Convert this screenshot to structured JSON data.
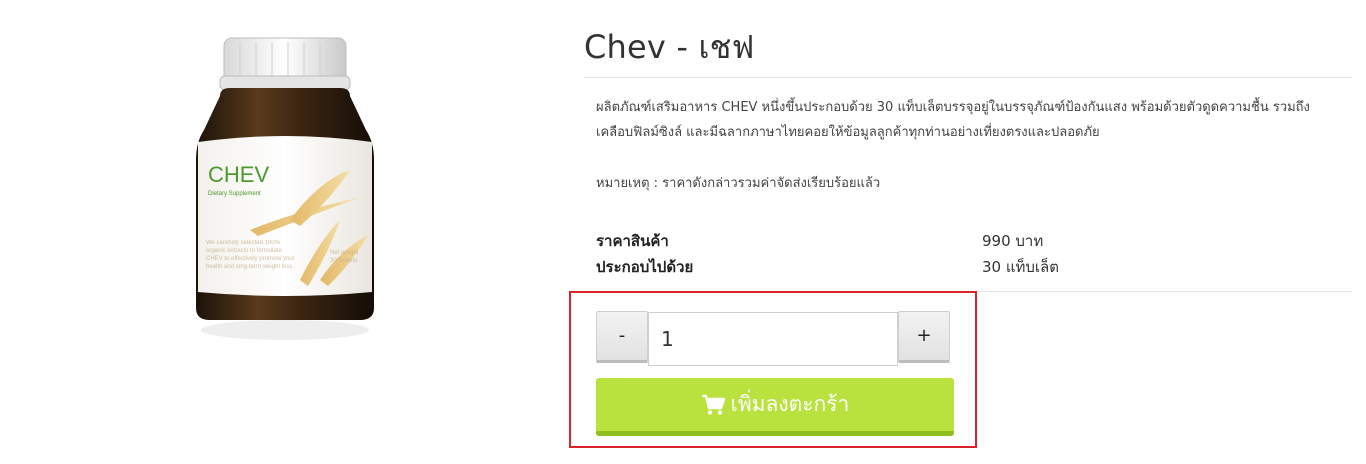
{
  "product": {
    "title": "Chev - เชฟ",
    "description": "ผลิตภัณฑ์เสริมอาหาร CHEV หนึ่งขึ้นประกอบด้วย 30 แท็บเล็ตบรรจุอยู่ในบรรจุภัณฑ์ป้องกันแสง พร้อมด้วยตัวดูดความชื้น รวมถึงเคลือบฟิลม์ซิงล์ และมีฉลากภาษาไทยคอยให้ข้อมูลลูกค้าทุกท่านอย่างเที่ยงตรงและปลอดภัย",
    "note": "หมายเหตุ : ราคาดังกล่าวรวมค่าจัดส่งเรียบร้อยแล้ว",
    "image": {
      "brand": "CHEV",
      "subtitle": "Dietary Supplement",
      "label_text": "We carefully selected 100% organic extracts to formulate CHEV to effectively promote your health and long-term weight loss.",
      "side_text": "Net weight 30 Tablets"
    }
  },
  "specs": {
    "price_label": "ราคาสินค้า",
    "price_value": "990 บาท",
    "contents_label": "ประกอบไปด้วย",
    "contents_value": "30 แท็บเล็ต"
  },
  "cart": {
    "minus_label": "-",
    "plus_label": "+",
    "quantity": "1",
    "add_label": "เพิ่มลงตะกร้า"
  },
  "colors": {
    "cart_button": "#b9e23e",
    "highlight_border": "#d9242b",
    "brand_green": "#4a9a2e"
  },
  "icons": {
    "cart": "shopping-cart-icon"
  }
}
